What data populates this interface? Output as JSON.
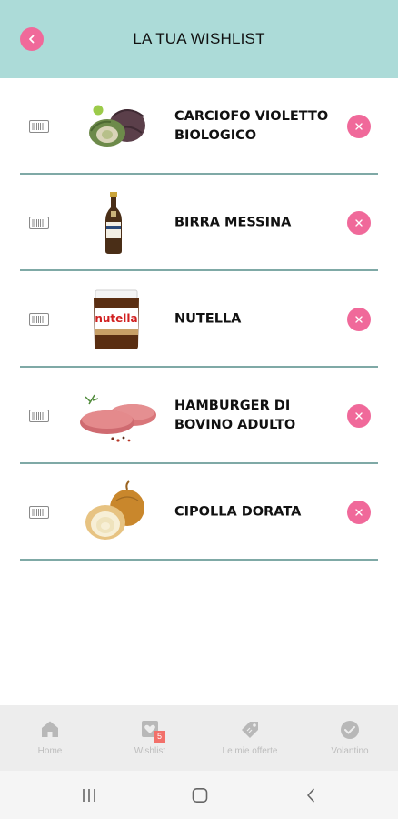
{
  "header": {
    "title": "LA TUA WISHLIST",
    "back_icon": "chevron-left-icon"
  },
  "colors": {
    "header_bg": "#acdbd8",
    "accent": "#f0699a",
    "divider": "#7fa9a6",
    "badge": "#f2706a"
  },
  "wishlist": {
    "items": [
      {
        "name": "CARCIOFO VIOLETTO BIOLOGICO",
        "image": "artichoke-image"
      },
      {
        "name": "BIRRA MESSINA",
        "image": "beer-bottle-image"
      },
      {
        "name": "NUTELLA",
        "image": "nutella-jar-image",
        "brand_label": "nutella"
      },
      {
        "name": "HAMBURGER DI BOVINO ADULTO",
        "image": "hamburger-patties-image"
      },
      {
        "name": "CIPOLLA DORATA",
        "image": "onion-image"
      }
    ]
  },
  "bottom_nav": {
    "items": [
      {
        "label": "Home",
        "icon": "home-icon"
      },
      {
        "label": "Wishlist",
        "icon": "wishlist-heart-icon",
        "badge": "5"
      },
      {
        "label": "Le mie offerte",
        "icon": "tag-icon"
      },
      {
        "label": "Volantino",
        "icon": "check-circle-icon"
      }
    ]
  },
  "system_nav": {
    "items": [
      "recent-apps-icon",
      "home-circle-icon",
      "back-chevron-icon"
    ]
  }
}
